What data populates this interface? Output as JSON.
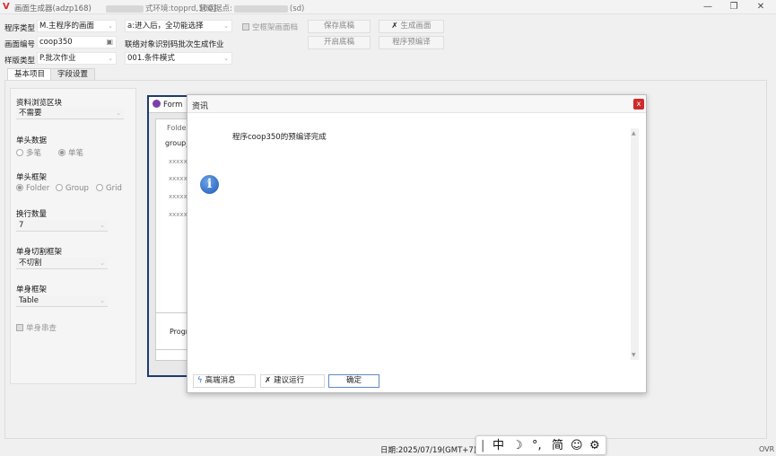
{
  "window": {
    "title": "画面生成器(adzp168)",
    "env_label": "式环境:topprd,100]",
    "site_label": "营运据点:",
    "site_suffix": "(sd)",
    "controls": {
      "minimize": "—",
      "maximize": "❐",
      "close": "✕"
    }
  },
  "form": {
    "program_type": {
      "label": "程序类型",
      "value": "M.主程序的画面"
    },
    "entry_mode": {
      "value": "a:进入后，全功能选择"
    },
    "empty_frame": {
      "label": "空框架画面档"
    },
    "save_draft": "保存底稿",
    "generate": "生成画面",
    "program_no": {
      "label": "画面编号",
      "value": "coop350"
    },
    "link_note": "联络对象识别码批次生成作业",
    "open_draft": "开启底稿",
    "precompile": "程序预编译",
    "template_type": {
      "label": "样版类型",
      "value": "P.批次作业"
    },
    "condition_mode": {
      "value": "001.条件模式"
    }
  },
  "tabs": [
    {
      "label": "基本项目",
      "active": true
    },
    {
      "label": "字段设置",
      "active": false
    }
  ],
  "left_panel": {
    "browse_block": {
      "label": "资料浏览区块",
      "value": "不需要"
    },
    "header_data": {
      "label": "单头数据",
      "options": [
        "多笔",
        "单笔"
      ],
      "selected": "单笔"
    },
    "header_frame": {
      "label": "单头框架",
      "options": [
        "Folder",
        "Group",
        "Grid"
      ],
      "selected": "Folder"
    },
    "line_count": {
      "label": "换行数量",
      "value": "7"
    },
    "body_split": {
      "label": "单身切割框架",
      "value": "不切割"
    },
    "body_frame": {
      "label": "单身框架",
      "value": "Table"
    },
    "body_chain": {
      "label": "单身串查"
    }
  },
  "preview": {
    "title": "Form",
    "folder": "Folder",
    "group": "group_",
    "rows": [
      "xxxxx",
      "xxxxx",
      "xxxxx",
      "xxxxx"
    ],
    "progress": "Progr"
  },
  "dialog": {
    "title": "资讯",
    "message": "程序coop350的预编译完成",
    "close": "x",
    "info_glyph": "i",
    "buttons": {
      "advanced": "高端消息",
      "suggest": "建议运行",
      "ok": "确定"
    }
  },
  "status": {
    "date": "日期:2025/07/19(GMT+7)",
    "ovr": "OVR",
    "ime": [
      "|",
      "中",
      "☽",
      "°,",
      "简",
      "☺",
      "⚙"
    ]
  }
}
